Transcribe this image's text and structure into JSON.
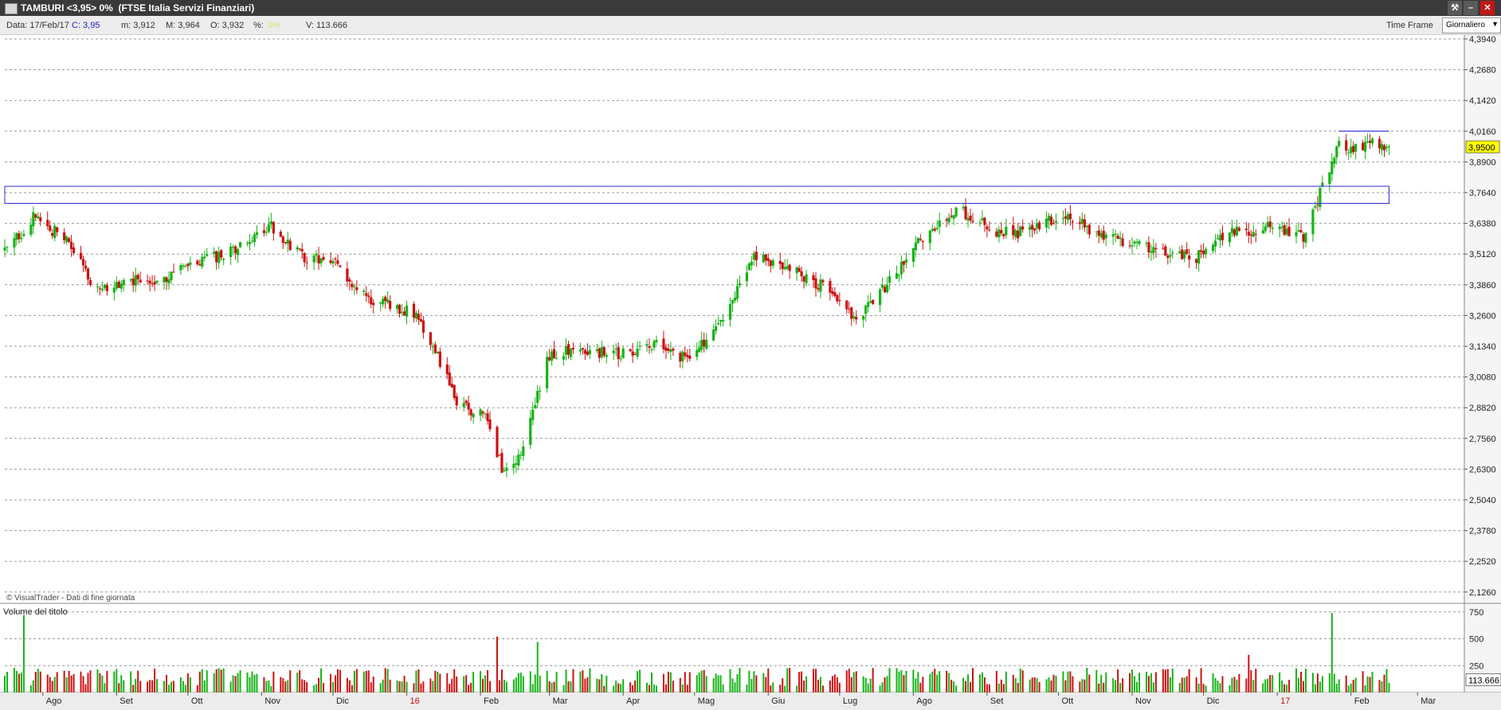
{
  "window": {
    "title": "TAMBURI <3,95> 0%  (FTSE Italia Servizi Finanziari)",
    "controls": [
      "⚒",
      "–",
      "✕"
    ]
  },
  "info": {
    "date": "Data: 17/Feb/17",
    "close": "C: 3,95",
    "min": "m: 3,912",
    "max": "M: 3,964",
    "open": "O: 3,932",
    "pct_label": "%:",
    "pct_value": "0%",
    "volume": "V: 113.666",
    "timeframe_label": "Time Frame",
    "timeframe_value": "Giornaliero"
  },
  "colors": {
    "up": "#16b316",
    "down": "#cc1111",
    "box": "#2b2bd6",
    "current_bg": "#ffff00",
    "titlebar": "#3a3a3a"
  },
  "chart_data": {
    "type": "candlestick",
    "title": "",
    "credit": "© VisualTrader - Dati di fine giornata",
    "current_price_label": "3,9500",
    "current_volume_label": "113.666",
    "y_ticks": [
      "4,3940",
      "4,2680",
      "4,1420",
      "4,0160",
      "3,8900",
      "3,7640",
      "3,6380",
      "3,5120",
      "3,3860",
      "3,2600",
      "3,1340",
      "3,0080",
      "2,8820",
      "2,7560",
      "2,6300",
      "2,5040",
      "2,3780",
      "2,2520",
      "2,1260"
    ],
    "ylim": [
      2.1,
      4.4
    ],
    "x_labels": [
      "Ago",
      "Set",
      "Ott",
      "Nov",
      "Dic",
      "16",
      "Feb",
      "Mar",
      "Apr",
      "Mag",
      "Giu",
      "Lug",
      "Ago",
      "Set",
      "Ott",
      "Nov",
      "Dic",
      "17",
      "Feb",
      "Mar"
    ],
    "x_range": [
      "2015-07-16",
      "2017-03-20"
    ],
    "close_series": {
      "dates": [
        "2015-07-16",
        "2015-07-28",
        "2015-08-10",
        "2015-08-24",
        "2015-09-08",
        "2015-09-22",
        "2015-10-06",
        "2015-10-20",
        "2015-11-05",
        "2015-11-18",
        "2015-12-01",
        "2015-12-15",
        "2016-01-04",
        "2016-01-13",
        "2016-01-22",
        "2016-02-03",
        "2016-02-11",
        "2016-02-19",
        "2016-03-01",
        "2016-03-15",
        "2016-03-30",
        "2016-04-14",
        "2016-04-28",
        "2016-05-12",
        "2016-05-26",
        "2016-06-10",
        "2016-06-24",
        "2016-07-08",
        "2016-07-22",
        "2016-08-05",
        "2016-08-19",
        "2016-09-05",
        "2016-09-19",
        "2016-10-03",
        "2016-10-17",
        "2016-10-31",
        "2016-11-14",
        "2016-11-28",
        "2016-12-12",
        "2016-12-28",
        "2017-01-12",
        "2017-01-19",
        "2017-01-27",
        "2017-02-03",
        "2017-02-10",
        "2017-02-17"
      ],
      "values": [
        3.52,
        3.66,
        3.58,
        3.36,
        3.4,
        3.42,
        3.48,
        3.52,
        3.63,
        3.5,
        3.48,
        3.33,
        3.27,
        3.12,
        2.9,
        2.85,
        2.6,
        2.72,
        3.1,
        3.12,
        3.1,
        3.14,
        3.08,
        3.22,
        3.5,
        3.45,
        3.38,
        3.25,
        3.4,
        3.58,
        3.7,
        3.6,
        3.6,
        3.68,
        3.6,
        3.56,
        3.52,
        3.5,
        3.6,
        3.62,
        3.58,
        3.76,
        3.96,
        3.94,
        3.98,
        3.95
      ]
    },
    "resistance_line": {
      "date_from": "2017-01-27",
      "date_to": "2017-02-17",
      "value": 4.016
    },
    "range_box": {
      "date_from": "2015-07-16",
      "date_to": "2017-02-17",
      "low": 3.72,
      "high": 3.79
    },
    "volume_panel": {
      "title": "Volume del titolo",
      "y_ticks": [
        "750",
        "500",
        "250"
      ],
      "ylim": [
        0,
        800
      ],
      "peaks": [
        {
          "date": "2015-07-24",
          "value": 720
        },
        {
          "date": "2016-02-08",
          "value": 520
        },
        {
          "date": "2016-02-25",
          "value": 470
        },
        {
          "date": "2017-01-24",
          "value": 740
        },
        {
          "date": "2016-12-20",
          "value": 350
        }
      ]
    }
  }
}
